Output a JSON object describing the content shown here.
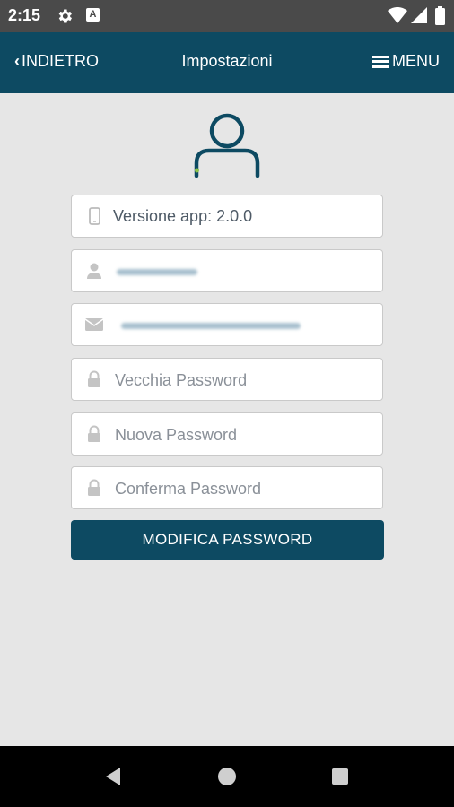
{
  "status_bar": {
    "time": "2:15",
    "icons": [
      "gear-icon",
      "a-icon",
      "wifi-icon",
      "signal-icon",
      "battery-icon"
    ],
    "a_label": "A"
  },
  "header": {
    "back_label": "INDIETRO",
    "title": "Impostazioni",
    "menu_label": "MENU"
  },
  "form": {
    "app_version": "Versione app: 2.0.0",
    "old_password_placeholder": "Vecchia Password",
    "new_password_placeholder": "Nuova Password",
    "confirm_password_placeholder": "Conferma Password",
    "submit_label": "MODIFICA PASSWORD"
  },
  "colors": {
    "primary": "#0d4a62",
    "background": "#e6e6e6",
    "avatar_accent": "#8bc34a"
  }
}
